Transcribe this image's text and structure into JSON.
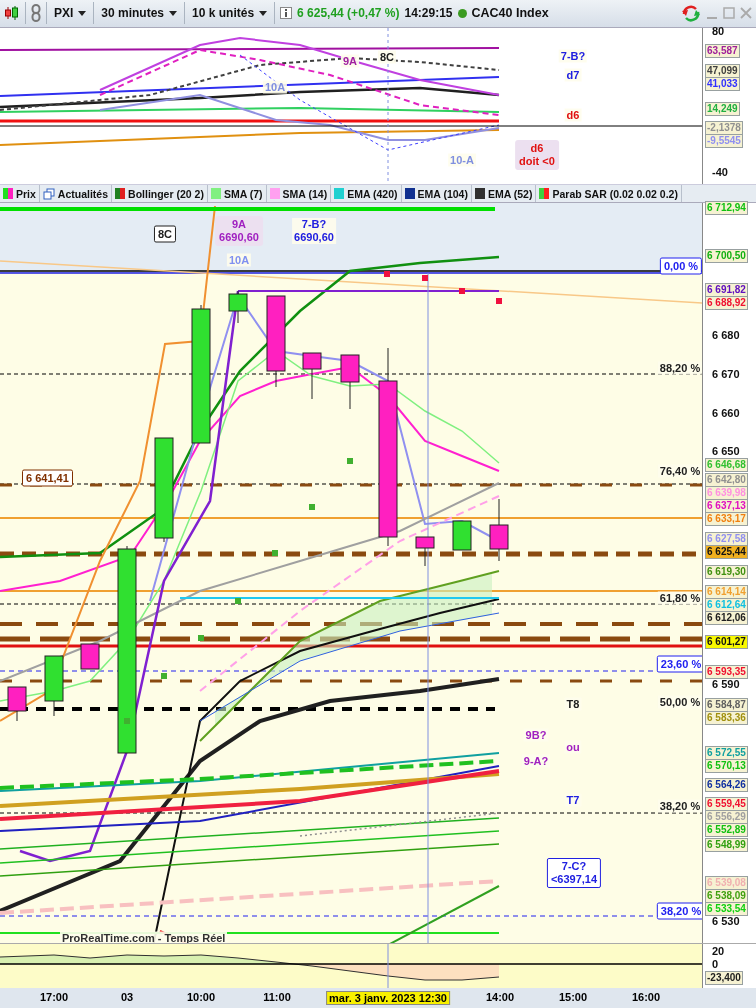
{
  "toolbar": {
    "symbol": "PXI",
    "interval": "30 minutes",
    "units": "10 k unités",
    "quote": "6 625,44 (+0,47 %)",
    "time": "14:29:15",
    "instrument": "CAC40 Index"
  },
  "upper_panel": {
    "axis": [
      {
        "kind": "tick",
        "value": "80"
      },
      {
        "kind": "tag",
        "value": "63,587",
        "color": "#a0209a"
      },
      {
        "kind": "tag",
        "value": "47,099",
        "color": "#404040"
      },
      {
        "kind": "tag",
        "value": "41,033",
        "color": "#3030ff"
      },
      {
        "kind": "tag",
        "value": "14,249",
        "color": "#20b040"
      },
      {
        "kind": "tag",
        "value": "-2,1378",
        "color": "#909090"
      },
      {
        "kind": "tag",
        "value": "-9,5545",
        "color": "#9090f0"
      },
      {
        "kind": "tick",
        "value": "-40"
      }
    ],
    "annotations": [
      {
        "kind": "plain",
        "text": "9A",
        "color": "#a020a0"
      },
      {
        "kind": "plain",
        "text": "8C",
        "color": "#202020"
      },
      {
        "kind": "plain",
        "text": "10A",
        "color": "#8090e0"
      },
      {
        "kind": "plain",
        "text": "7-B?",
        "color": "#2020e0"
      },
      {
        "kind": "plain",
        "text": "d7",
        "color": "#2020e0"
      },
      {
        "kind": "plain",
        "text": "d6",
        "color": "#e01010"
      },
      {
        "kind": "plain",
        "text": "10-A",
        "color": "#8090e0"
      },
      {
        "kind": "filled",
        "text": "d6\ndoit <0",
        "color": "#e01010"
      }
    ]
  },
  "legend": [
    {
      "kind": "swatch",
      "label": "Prix",
      "swatch": [
        {
          "color": "#20e020"
        },
        {
          "color": "#ff20c0"
        }
      ]
    },
    {
      "kind": "news",
      "label": "Actualités"
    },
    {
      "kind": "swatch",
      "label": "Bollinger (20 2)",
      "swatch": [
        {
          "color": "#208020"
        },
        {
          "color": "#e02020"
        }
      ]
    },
    {
      "kind": "swatch",
      "label": "SMA (7)",
      "swatch": [
        {
          "color": "#80f080"
        }
      ]
    },
    {
      "kind": "swatch",
      "label": "SMA (14)",
      "swatch": [
        {
          "color": "#ffa0f0"
        }
      ]
    },
    {
      "kind": "swatch",
      "label": "EMA (420)",
      "swatch": [
        {
          "color": "#20d0d0"
        }
      ]
    },
    {
      "kind": "swatch",
      "label": "EMA (104)",
      "swatch": [
        {
          "color": "#103090"
        }
      ]
    },
    {
      "kind": "swatch",
      "label": "EMA (52)",
      "swatch": [
        {
          "color": "#303030"
        }
      ]
    },
    {
      "kind": "swatch",
      "label": "Parab SAR (0.02 0.02 0.2)",
      "swatch": [
        {
          "color": "#40d040"
        },
        {
          "color": "#ff2020"
        }
      ]
    }
  ],
  "main_panel": {
    "axis": [
      {
        "kind": "tag",
        "value": "6 712,94",
        "color": "#10c010"
      },
      {
        "kind": "tag",
        "value": "6 700,50",
        "color": "#10b010"
      },
      {
        "kind": "tag",
        "value": "6 691,82",
        "color": "#6010c0"
      },
      {
        "kind": "tag",
        "value": "6 688,92",
        "color": "#f01030"
      },
      {
        "kind": "tick",
        "value": "6 680"
      },
      {
        "kind": "tick",
        "value": "6 670"
      },
      {
        "kind": "tick",
        "value": "6 660"
      },
      {
        "kind": "tick",
        "value": "6 650"
      },
      {
        "kind": "tag",
        "value": "6 646,68",
        "color": "#30c030"
      },
      {
        "kind": "tag",
        "value": "6 642,80",
        "color": "#909090"
      },
      {
        "kind": "tag",
        "value": "6 639,98",
        "color": "#ff90e0"
      },
      {
        "kind": "tag",
        "value": "6 637,13",
        "color": "#e010c0"
      },
      {
        "kind": "tag",
        "value": "6 633,17",
        "color": "#f08010"
      },
      {
        "kind": "tag",
        "value": "6 627,58",
        "color": "#9090f0"
      },
      {
        "kind": "current",
        "value": "6 625,44"
      },
      {
        "kind": "tag",
        "value": "6 619,30",
        "color": "#409010"
      },
      {
        "kind": "tag",
        "value": "6 614,14",
        "color": "#f0a030"
      },
      {
        "kind": "tag",
        "value": "6 612,64",
        "color": "#10c0e0"
      },
      {
        "kind": "tag",
        "value": "6 612,06",
        "color": "#202020"
      },
      {
        "kind": "marked",
        "value": "6 601,27"
      },
      {
        "kind": "tag",
        "value": "6 593,35",
        "color": "#f01030"
      },
      {
        "kind": "tick",
        "value": "6 590"
      },
      {
        "kind": "tag",
        "value": "6 584,87",
        "color": "#606060"
      },
      {
        "kind": "tag",
        "value": "6 583,36",
        "color": "#a09010"
      },
      {
        "kind": "tag",
        "value": "6 572,55",
        "color": "#10a0a0"
      },
      {
        "kind": "tag",
        "value": "6 570,13",
        "color": "#10c010"
      },
      {
        "kind": "tag",
        "value": "6 564,26",
        "color": "#1030a0"
      },
      {
        "kind": "tag",
        "value": "6 559,45",
        "color": "#f01030"
      },
      {
        "kind": "tag",
        "value": "6 556,29",
        "color": "#a0a0a0"
      },
      {
        "kind": "tag",
        "value": "6 552,89",
        "color": "#10c010"
      },
      {
        "kind": "tag",
        "value": "6 548,99",
        "color": "#30a010"
      },
      {
        "kind": "tag",
        "value": "6 539,08",
        "color": "#f0b0b0"
      },
      {
        "kind": "tag",
        "value": "6 538,09",
        "color": "#40a010"
      },
      {
        "kind": "tag",
        "value": "6 533,54",
        "color": "#10d010"
      },
      {
        "kind": "tick",
        "value": "6 530"
      }
    ],
    "annotations": [
      {
        "kind": "boxed",
        "text": "8C",
        "color": "#202020"
      },
      {
        "kind": "filled",
        "text": "9A\n6690,60",
        "color": "#a020c0"
      },
      {
        "kind": "plain",
        "text": "7-B?\n6690,60",
        "color": "#2020e0"
      },
      {
        "kind": "plain",
        "text": "10A",
        "color": "#8090f0"
      },
      {
        "kind": "boxed",
        "text": "0,00 %",
        "color": "#2020f0"
      },
      {
        "kind": "plain",
        "text": "88,20 %",
        "color": "#202020"
      },
      {
        "kind": "plain",
        "text": "76,40 %",
        "color": "#202020"
      },
      {
        "kind": "boxed",
        "text": "6 641,41",
        "color": "#803000"
      },
      {
        "kind": "plain",
        "text": "61,80 %",
        "color": "#202020"
      },
      {
        "kind": "boxed",
        "text": "23,60 %",
        "color": "#2020f0"
      },
      {
        "kind": "plain",
        "text": "50,00 %",
        "color": "#202020"
      },
      {
        "kind": "plain",
        "text": "T8",
        "color": "#202020"
      },
      {
        "kind": "plain",
        "text": "9B?",
        "color": "#a020c0"
      },
      {
        "kind": "plain",
        "text": "ou",
        "color": "#a020c0"
      },
      {
        "kind": "plain",
        "text": "9-A?",
        "color": "#a020c0"
      },
      {
        "kind": "plain",
        "text": "T7",
        "color": "#2020e0"
      },
      {
        "kind": "plain",
        "text": "38,20 %",
        "color": "#202020"
      },
      {
        "kind": "boxed",
        "text": "7-C?\n<6397,14",
        "color": "#2020e0"
      },
      {
        "kind": "boxed",
        "text": "38,20 %",
        "color": "#2020f0"
      },
      {
        "kind": "plain",
        "text": "ProRealTime.com - Temps Réel",
        "color": "#303030"
      }
    ]
  },
  "lower_panel": {
    "axis": [
      {
        "kind": "tick",
        "value": "20"
      },
      {
        "kind": "tick",
        "value": "0"
      },
      {
        "kind": "tag",
        "value": "-23,400",
        "color": "#202020"
      }
    ]
  },
  "time_axis": [
    {
      "label": "17:00",
      "selected": false
    },
    {
      "label": "03",
      "selected": false
    },
    {
      "label": "10:00",
      "selected": false
    },
    {
      "label": "11:00",
      "selected": false
    },
    {
      "label": "mar. 3 janv. 2023 12:30",
      "selected": true
    },
    {
      "label": "14:00",
      "selected": false
    },
    {
      "label": "15:00",
      "selected": false
    },
    {
      "label": "16:00",
      "selected": false
    }
  ]
}
